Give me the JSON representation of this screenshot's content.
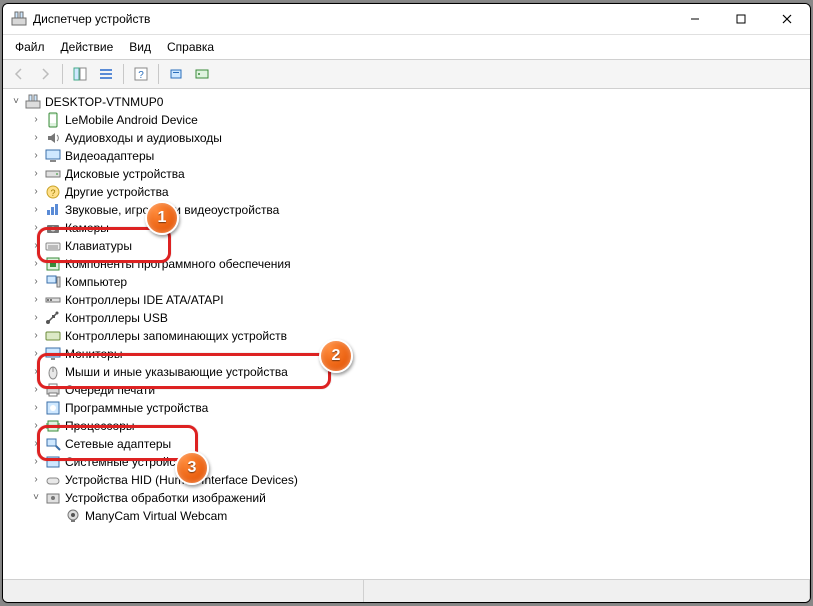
{
  "window": {
    "title": "Диспетчер устройств"
  },
  "menu": {
    "file": "Файл",
    "action": "Действие",
    "view": "Вид",
    "help": "Справка"
  },
  "toolbar": {
    "back": "←",
    "fwd": "→",
    "show_hidden": "▦",
    "props": "☰",
    "help": "?",
    "scan": "⟳",
    "view2": "▭"
  },
  "tree": {
    "root": "DESKTOP-VTNMUP0",
    "items": [
      {
        "label": "LeMobile Android Device"
      },
      {
        "label": "Аудиовходы и аудиовыходы"
      },
      {
        "label": "Видеоадаптеры"
      },
      {
        "label": "Дисковые устройства"
      },
      {
        "label": "Другие устройства"
      },
      {
        "label": "Звуковые, игровые и видеоустройства"
      },
      {
        "label": "Камеры"
      },
      {
        "label": "Клавиатуры"
      },
      {
        "label": "Компоненты программного обеспечения"
      },
      {
        "label": "Компьютер"
      },
      {
        "label": "Контроллеры IDE ATA/ATAPI"
      },
      {
        "label": "Контроллеры USB"
      },
      {
        "label": "Контроллеры запоминающих устройств"
      },
      {
        "label": "Мониторы"
      },
      {
        "label": "Мыши и иные указывающие устройства"
      },
      {
        "label": "Очереди печати"
      },
      {
        "label": "Программные устройства"
      },
      {
        "label": "Процессоры"
      },
      {
        "label": "Сетевые адаптеры"
      },
      {
        "label": "Системные устройства"
      },
      {
        "label": "Устройства HID (Human Interface Devices)"
      },
      {
        "label": "Устройства обработки изображений"
      }
    ],
    "child_manycam": "ManyCam Virtual Webcam"
  },
  "callouts": {
    "one": "1",
    "two": "2",
    "three": "3"
  }
}
